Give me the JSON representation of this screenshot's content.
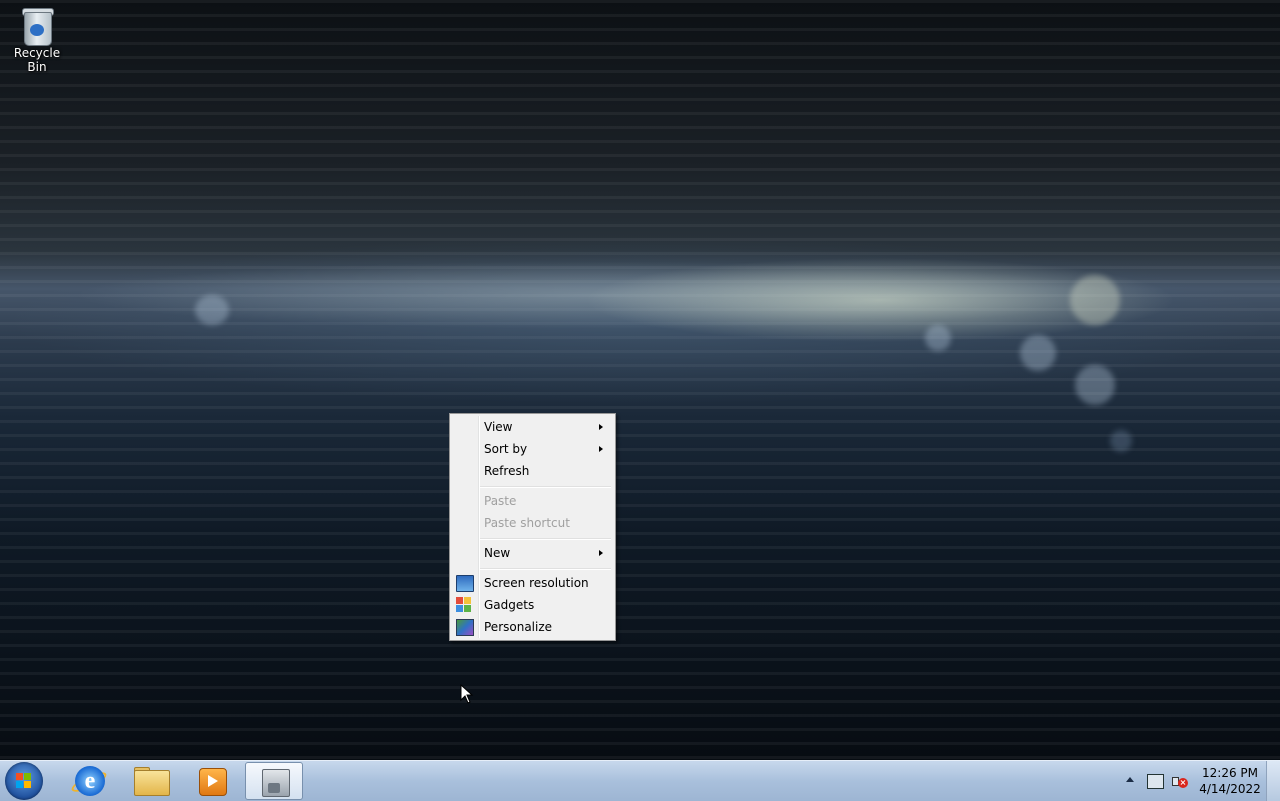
{
  "desktop": {
    "icons": [
      {
        "label": "Recycle Bin",
        "icon": "recycle-bin-icon"
      }
    ]
  },
  "context_menu": {
    "items": [
      {
        "label": "View",
        "submenu": true,
        "enabled": true
      },
      {
        "label": "Sort by",
        "submenu": true,
        "enabled": true
      },
      {
        "label": "Refresh",
        "submenu": false,
        "enabled": true
      },
      {
        "label": "Paste",
        "submenu": false,
        "enabled": false
      },
      {
        "label": "Paste shortcut",
        "submenu": false,
        "enabled": false
      },
      {
        "label": "New",
        "submenu": true,
        "enabled": true
      },
      {
        "label": "Screen resolution",
        "icon": "screen-resolution-icon",
        "enabled": true
      },
      {
        "label": "Gadgets",
        "icon": "gadgets-icon",
        "enabled": true
      },
      {
        "label": "Personalize",
        "icon": "personalize-icon",
        "enabled": true
      }
    ]
  },
  "taskbar": {
    "pinned": [
      {
        "icon": "internet-explorer-icon"
      },
      {
        "icon": "windows-explorer-icon"
      },
      {
        "icon": "media-player-icon"
      },
      {
        "icon": "admin-tools-icon",
        "active": true
      }
    ],
    "clock": {
      "time": "12:26 PM",
      "date": "4/14/2022"
    },
    "tray_icons": [
      "show-hidden-icons-icon",
      "network-icon",
      "volume-muted-icon"
    ]
  }
}
